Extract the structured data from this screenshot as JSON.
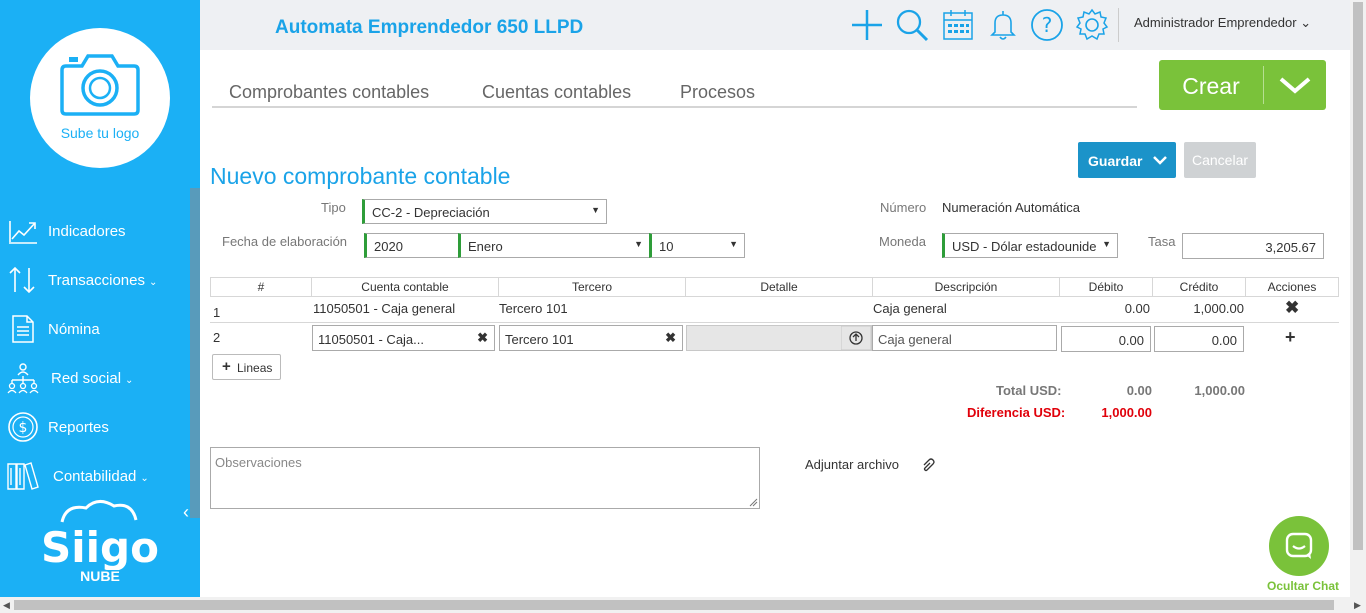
{
  "app": {
    "company": "Automata Emprendedor 650 LLPD",
    "user": "Administrador Emprendedor",
    "brand": "Siigo",
    "brand_sub": "NUBE"
  },
  "sidebar": {
    "logo_label": "Sube tu logo",
    "items": [
      {
        "label": "Indicadores",
        "icon": "chart-trend-icon",
        "has_submenu": false
      },
      {
        "label": "Transacciones",
        "icon": "transfer-arrows-icon",
        "has_submenu": true
      },
      {
        "label": "Nómina",
        "icon": "document-icon",
        "has_submenu": false
      },
      {
        "label": "Red social",
        "icon": "network-people-icon",
        "has_submenu": true
      },
      {
        "label": "Reportes",
        "icon": "dollar-circle-icon",
        "has_submenu": false
      },
      {
        "label": "Contabilidad",
        "icon": "books-icon",
        "has_submenu": true
      }
    ]
  },
  "topbar_icons": [
    "plus-icon",
    "search-icon",
    "calendar-icon",
    "bell-icon",
    "help-icon",
    "gear-icon"
  ],
  "tabs": [
    "Comprobantes contables",
    "Cuentas contables",
    "Procesos"
  ],
  "create_button": "Crear",
  "page_title": "Nuevo comprobante contable",
  "actions": {
    "save": "Guardar",
    "cancel": "Cancelar"
  },
  "form": {
    "tipo_label": "Tipo",
    "tipo_value": "CC-2 - Depreciación",
    "fecha_label": "Fecha de elaboración",
    "fecha_year": "2020",
    "fecha_month": "Enero",
    "fecha_day": "10",
    "numero_label": "Número",
    "numero_value": "Numeración Automática",
    "moneda_label": "Moneda",
    "moneda_value": "USD - Dólar estadounide",
    "tasa_label": "Tasa",
    "tasa_value": "3,205.67"
  },
  "table": {
    "headers": [
      "#",
      "Cuenta contable",
      "Tercero",
      "Detalle",
      "Descripción",
      "Débito",
      "Crédito",
      "Acciones"
    ],
    "rows": [
      {
        "num": "1",
        "cuenta": "11050501 - Caja general",
        "tercero": "Tercero 101",
        "detalle": "",
        "descripcion": "Caja general",
        "debito": "0.00",
        "credito": "1,000.00"
      },
      {
        "num": "2",
        "cuenta": "11050501 - Caja...",
        "tercero": "Tercero 101",
        "detalle": "",
        "descripcion": "Caja general",
        "debito": "0.00",
        "credito": "0.00"
      }
    ]
  },
  "lines_button": "Lineas",
  "totals": {
    "total_label": "Total USD:",
    "total_debito": "0.00",
    "total_credito": "1,000.00",
    "diff_label": "Diferencia USD:",
    "diff_value": "1,000.00"
  },
  "observations_placeholder": "Observaciones",
  "attach_label": "Adjuntar archivo",
  "chat_label": "Ocultar Chat",
  "colors": {
    "sidebar": "#1bb0f5",
    "accent": "#1aa3e8",
    "green": "#7ac23a",
    "save": "#1b93c9",
    "error": "#e0000a"
  }
}
